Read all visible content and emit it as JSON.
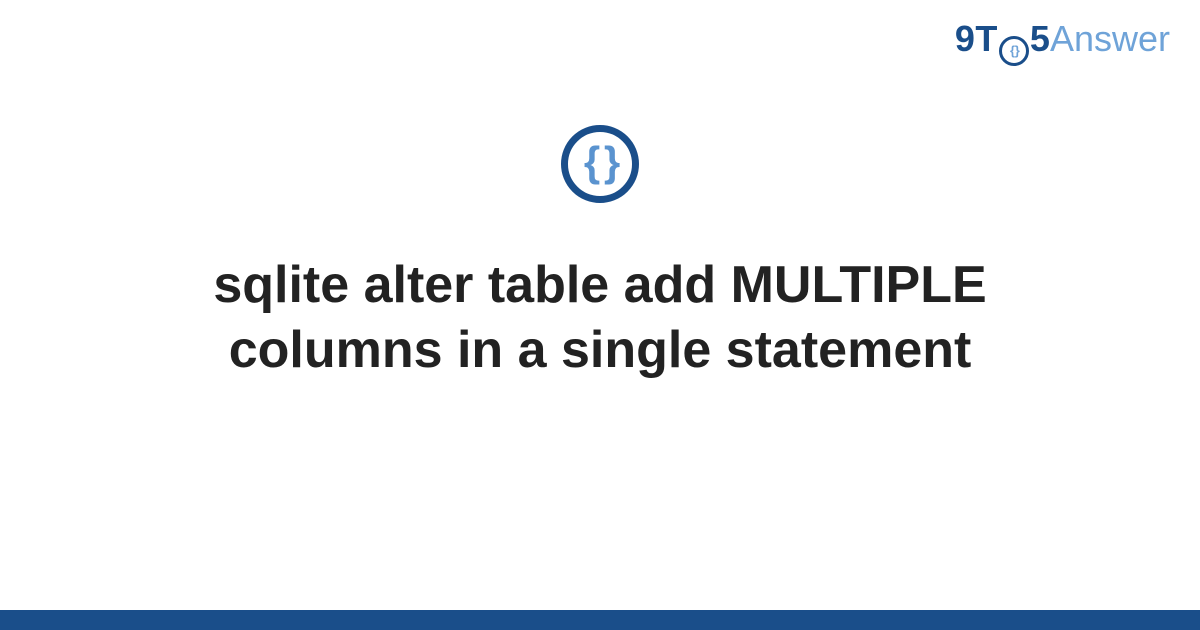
{
  "logo": {
    "part1": "9T",
    "inner_braces": "{ }",
    "part2": "5",
    "part3": "Answer"
  },
  "icon": {
    "name": "code-braces-icon",
    "braces": "{ }"
  },
  "title": "sqlite alter table add MULTIPLE columns in a single statement",
  "colors": {
    "brand_dark": "#1a4e8a",
    "brand_light": "#6fa3d8",
    "text": "#222222"
  }
}
